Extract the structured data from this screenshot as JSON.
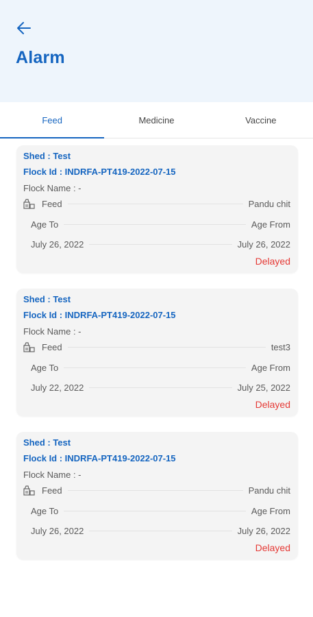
{
  "header": {
    "back_icon": "arrow-left-icon",
    "title": "Alarm",
    "accent_color": "#1565c0",
    "background": "#eef5fc"
  },
  "tabs": [
    {
      "label": "Feed",
      "active": true
    },
    {
      "label": "Medicine",
      "active": false
    },
    {
      "label": "Vaccine",
      "active": false
    }
  ],
  "cards": [
    {
      "shed": "Shed : Test",
      "flock_id": "Flock Id : INDRFA-PT419-2022-07-15",
      "flock_name": "Flock Name : -",
      "type_icon": "feed-bag-icon",
      "type_label": "Feed",
      "item": "Pandu chit",
      "age_to_label": "Age To",
      "age_from_label": "Age From",
      "age_to_date": "July 26, 2022",
      "age_from_date": "July 26, 2022",
      "status": "Delayed"
    },
    {
      "shed": "Shed : Test",
      "flock_id": "Flock Id : INDRFA-PT419-2022-07-15",
      "flock_name": "Flock Name : -",
      "type_icon": "feed-bag-icon",
      "type_label": "Feed",
      "item": "test3",
      "age_to_label": "Age To",
      "age_from_label": "Age From",
      "age_to_date": "July 22, 2022",
      "age_from_date": "July 25, 2022",
      "status": "Delayed"
    },
    {
      "shed": "Shed : Test",
      "flock_id": "Flock Id : INDRFA-PT419-2022-07-15",
      "flock_name": "Flock Name : -",
      "type_icon": "feed-bag-icon",
      "type_label": "Feed",
      "item": "Pandu chit",
      "age_to_label": "Age To",
      "age_from_label": "Age From",
      "age_to_date": "July 26, 2022",
      "age_from_date": "July 26, 2022",
      "status": "Delayed"
    }
  ],
  "status_color": "#e53935"
}
